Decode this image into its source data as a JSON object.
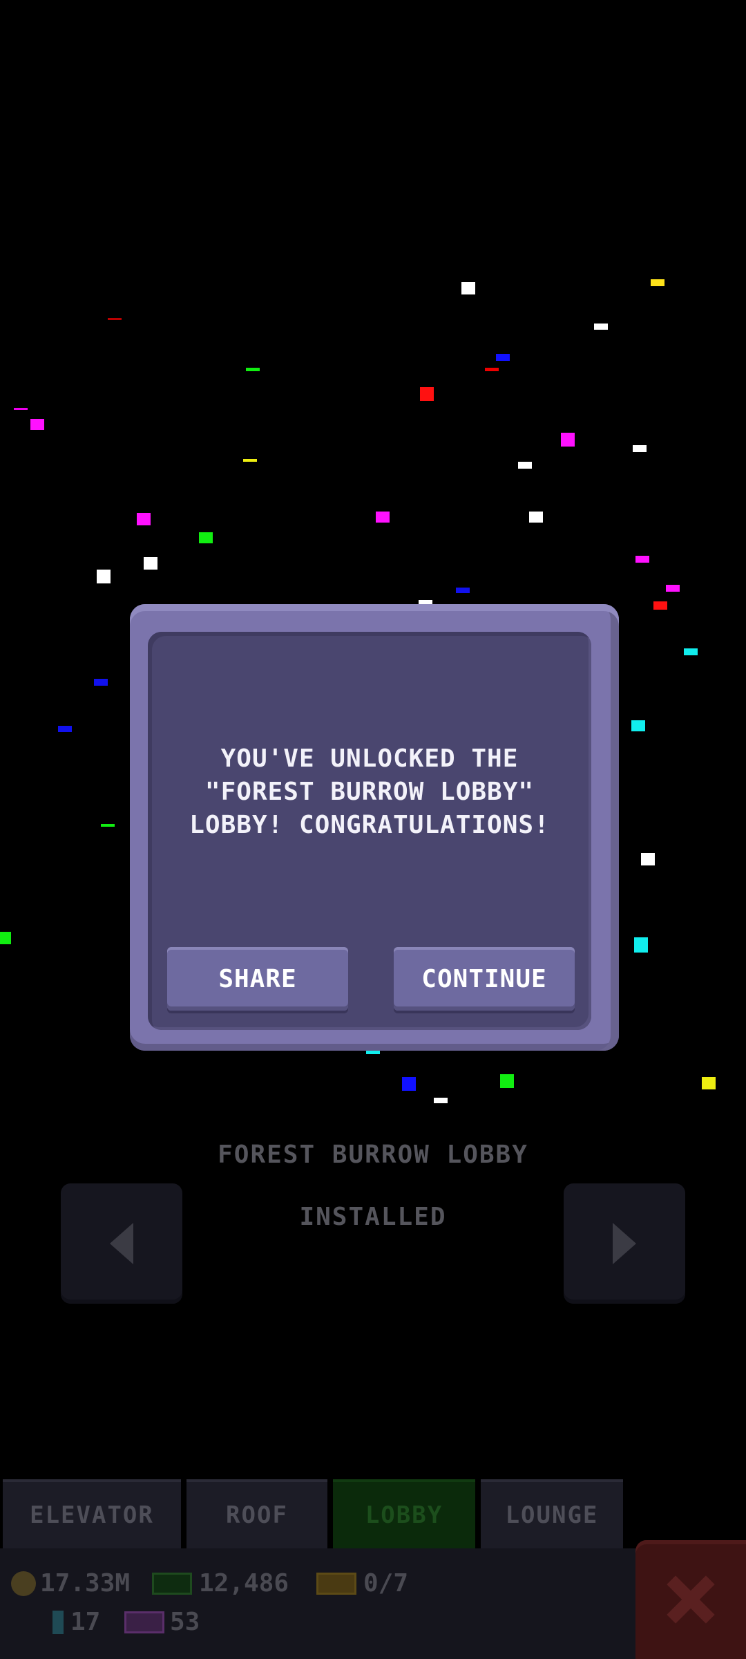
{
  "dialog": {
    "message": "YOU'VE UNLOCKED THE\n\"FOREST BURROW LOBBY\"\nLOBBY! CONGRATULATIONS!",
    "share_label": "SHARE",
    "continue_label": "CONTINUE"
  },
  "lobby_preview": {
    "name": "FOREST BURROW LOBBY",
    "status": "INSTALLED",
    "prev_icon": "triangle-left-icon",
    "next_icon": "triangle-right-icon"
  },
  "tabs": [
    {
      "label": "ELEVATOR",
      "active": false
    },
    {
      "label": "ROOF",
      "active": false
    },
    {
      "label": "LOBBY",
      "active": true
    },
    {
      "label": "LOUNGE",
      "active": false
    }
  ],
  "status": {
    "coins": "17.33M",
    "cash": "12,486",
    "tickets": "0/7",
    "gems": "17",
    "tv": "53"
  },
  "close_icon": "close-x-icon",
  "colors": {
    "background": "#000000",
    "dialog_frame": "#7b74ac",
    "dialog_body": "#4a466f",
    "active_tab": "#0b2a0b"
  }
}
